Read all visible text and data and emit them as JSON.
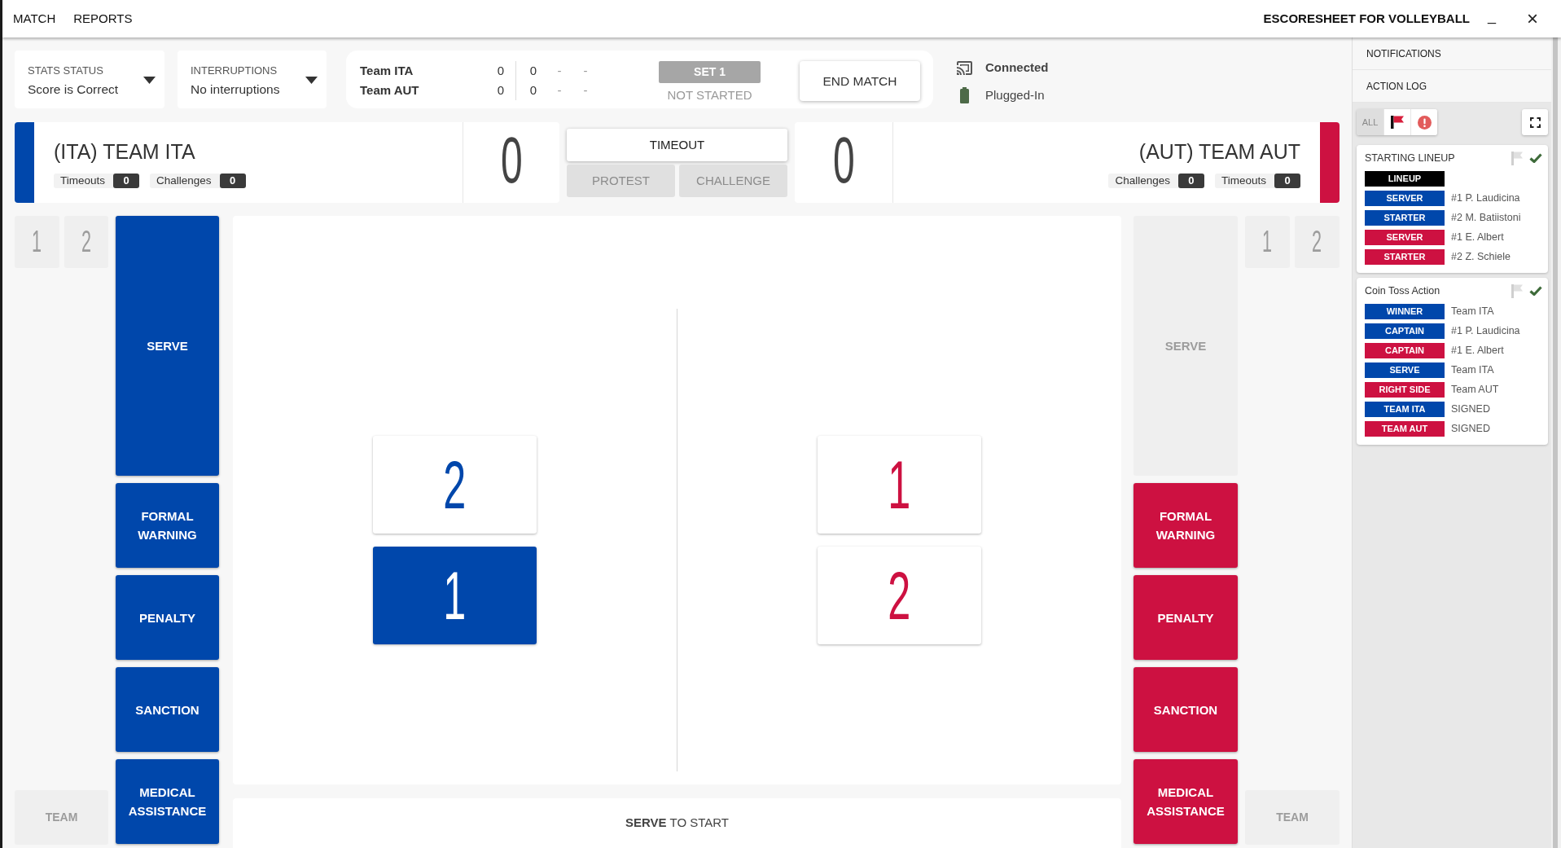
{
  "menu": [
    "MATCH",
    "REPORTS"
  ],
  "app_title": "ESCORESHEET FOR VOLLEYBALL",
  "window_controls": [
    {
      "kind": "minimize",
      "label": "_"
    },
    {
      "kind": "close",
      "label": "×"
    }
  ],
  "status_selectors": [
    {
      "label": "STATS STATUS",
      "value": "Score is Correct"
    },
    {
      "label": "INTERRUPTIONS",
      "value": "No interruptions"
    }
  ],
  "scoreboard": {
    "rows": [
      {
        "team": "Team ITA",
        "sets_won": "0",
        "set_scores": [
          "0",
          "-",
          "-"
        ]
      },
      {
        "team": "Team AUT",
        "sets_won": "0",
        "set_scores": [
          "0",
          "-",
          "-"
        ]
      }
    ],
    "set_label": "SET 1",
    "set_state": "NOT STARTED",
    "end_button": "END MATCH"
  },
  "connection": [
    {
      "kind": "cast",
      "label": "Connected"
    },
    {
      "kind": "battery",
      "label": "Plugged-In"
    }
  ],
  "teams": [
    {
      "name": "(ITA) TEAM ITA",
      "color": "#0047ab",
      "score": "0",
      "counters": [
        {
          "label": "Timeouts",
          "value": "0"
        },
        {
          "label": "Challenges",
          "value": "0"
        }
      ],
      "substitutes": [
        {
          "number": "1",
          "disabled": true
        },
        {
          "number": "2",
          "disabled": true
        }
      ],
      "team_button": {
        "label": "TEAM",
        "disabled": true
      },
      "actions": [
        {
          "label": "SERVE",
          "disabled": false
        },
        {
          "label": "FORMAL WARNING",
          "disabled": false
        },
        {
          "label": "PENALTY",
          "disabled": false
        },
        {
          "label": "SANCTION",
          "disabled": false
        },
        {
          "label": "MEDICAL ASSISTANCE",
          "disabled": false
        }
      ],
      "players": [
        {
          "number": "2",
          "serving": false
        },
        {
          "number": "1",
          "serving": true
        }
      ]
    },
    {
      "name": "(AUT) TEAM AUT",
      "color": "#cd1141",
      "score": "0",
      "counters": [
        {
          "label": "Challenges",
          "value": "0"
        },
        {
          "label": "Timeouts",
          "value": "0"
        }
      ],
      "substitutes": [
        {
          "number": "1",
          "disabled": true
        },
        {
          "number": "2",
          "disabled": true
        }
      ],
      "team_button": {
        "label": "TEAM",
        "disabled": true
      },
      "actions": [
        {
          "label": "SERVE",
          "disabled": true
        },
        {
          "label": "FORMAL WARNING",
          "disabled": false
        },
        {
          "label": "PENALTY",
          "disabled": false
        },
        {
          "label": "SANCTION",
          "disabled": false
        },
        {
          "label": "MEDICAL ASSISTANCE",
          "disabled": false
        }
      ],
      "players": [
        {
          "number": "1",
          "serving": false
        },
        {
          "number": "2",
          "serving": false
        }
      ]
    }
  ],
  "center_buttons": [
    {
      "label": "TIMEOUT",
      "disabled": false
    },
    {
      "label": "PROTEST",
      "disabled": true
    },
    {
      "label": "CHALLENGE",
      "disabled": true
    }
  ],
  "footer_prompt": "**SERVE** TO START",
  "sidebar": {
    "sections": [
      "NOTIFICATIONS",
      "ACTION LOG"
    ],
    "filters": [
      {
        "kind": "all",
        "label": "ALL",
        "selected": true
      },
      {
        "kind": "flag",
        "selected": false
      },
      {
        "kind": "alert",
        "selected": false
      }
    ],
    "log_entries": [
      {
        "title": "STARTING LINEUP",
        "flagged": false,
        "confirmed": true,
        "items": [
          {
            "tag": "LINEUP",
            "color": "#000000"
          },
          {
            "tag": "SERVER",
            "color": "#0047ab",
            "text": "#1 P. Laudicina"
          },
          {
            "tag": "STARTER",
            "color": "#0047ab",
            "text": "#2 M. Batiistoni"
          },
          {
            "tag": "SERVER",
            "color": "#cd1141",
            "text": "#1 E. Albert"
          },
          {
            "tag": "STARTER",
            "color": "#cd1141",
            "text": "#2 Z. Schiele"
          }
        ]
      },
      {
        "title": "Coin Toss Action",
        "flagged": false,
        "confirmed": true,
        "items": [
          {
            "tag": "WINNER",
            "color": "#0047ab",
            "text": "Team ITA"
          },
          {
            "tag": "CAPTAIN",
            "color": "#0047ab",
            "text": "#1 P. Laudicina"
          },
          {
            "tag": "CAPTAIN",
            "color": "#cd1141",
            "text": "#1 E. Albert"
          },
          {
            "tag": "SERVE",
            "color": "#0047ab",
            "text": "Team ITA"
          },
          {
            "tag": "RIGHT SIDE",
            "color": "#cd1141",
            "text": "Team AUT"
          },
          {
            "tag": "TEAM ITA",
            "color": "#0047ab",
            "text": "SIGNED"
          },
          {
            "tag": "TEAM AUT",
            "color": "#cd1141",
            "text": "SIGNED"
          }
        ]
      }
    ]
  }
}
